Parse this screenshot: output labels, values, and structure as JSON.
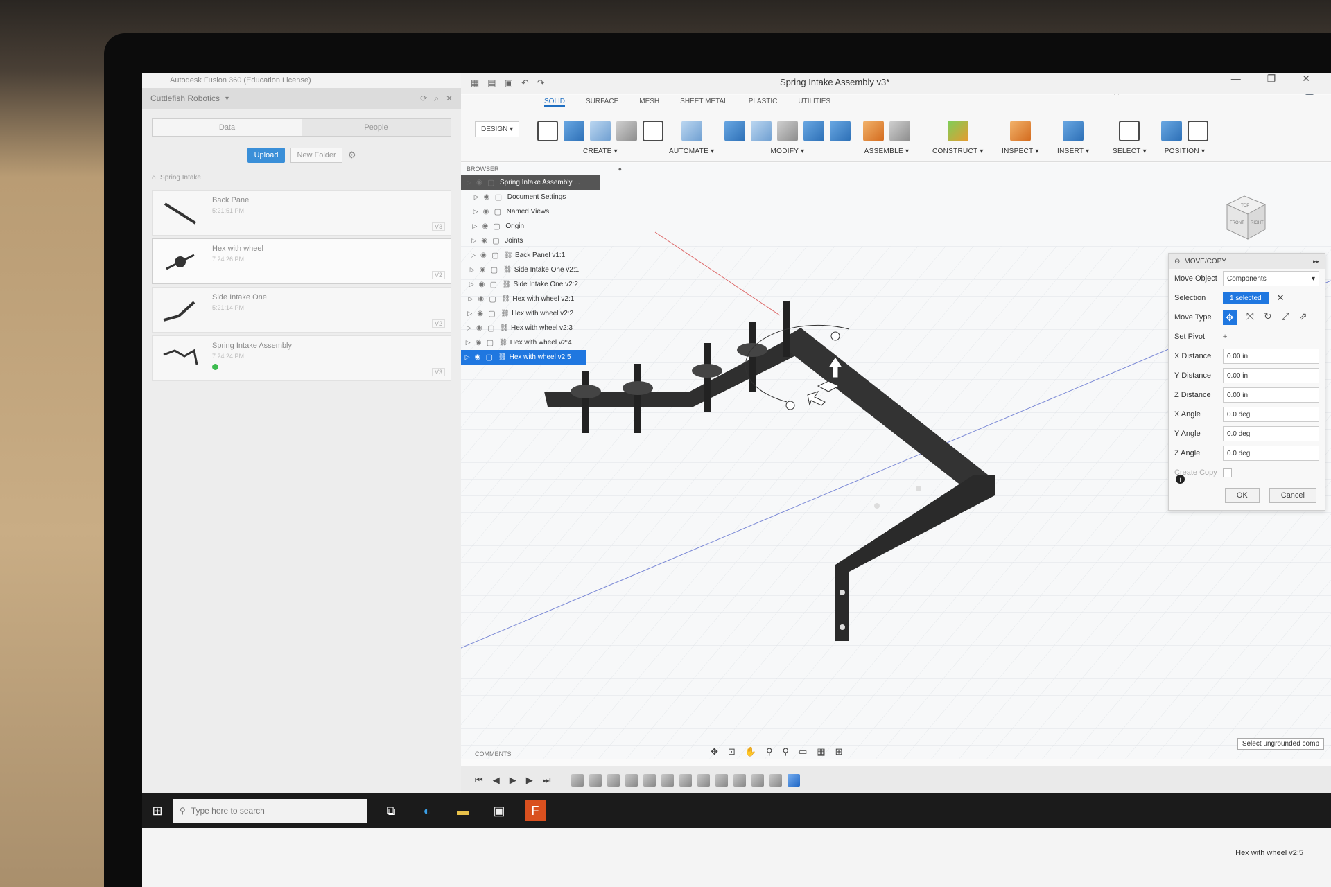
{
  "data_panel": {
    "app_title": "Autodesk Fusion 360 (Education License)",
    "team_name": "Cuttlefish Robotics",
    "tabs": [
      "Data",
      "People"
    ],
    "upload_label": "Upload",
    "new_folder_label": "New Folder",
    "breadcrumb": "Spring Intake",
    "items": [
      {
        "name": "Back Panel",
        "date": "5:21:51 PM",
        "version": "V3"
      },
      {
        "name": "Hex with wheel",
        "date": "7:24:26 PM",
        "version": "V2"
      },
      {
        "name": "Side Intake One",
        "date": "5:21:14 PM",
        "version": "V2"
      },
      {
        "name": "Spring Intake Assembly",
        "date": "7:24:24 PM",
        "version": "V3"
      }
    ]
  },
  "window": {
    "doc_title": "Spring Intake Assembly v3*",
    "controls": [
      "—",
      "❐",
      "✕"
    ]
  },
  "toolbar": {
    "workspace_tabs": [
      "SOLID",
      "SURFACE",
      "MESH",
      "SHEET METAL",
      "PLASTIC",
      "UTILITIES"
    ],
    "design_label": "DESIGN ▾",
    "groups": [
      "CREATE ▾",
      "AUTOMATE ▾",
      "MODIFY ▾",
      "ASSEMBLE ▾",
      "CONSTRUCT ▾",
      "INSPECT ▾",
      "INSERT ▾",
      "SELECT ▾",
      "POSITION ▾"
    ]
  },
  "browser": {
    "title": "BROWSER",
    "rows": [
      {
        "label": "Spring Intake Assembly ...",
        "kind": "root"
      },
      {
        "label": "Document Settings",
        "kind": "normal"
      },
      {
        "label": "Named Views",
        "kind": "normal"
      },
      {
        "label": "Origin",
        "kind": "normal"
      },
      {
        "label": "Joints",
        "kind": "normal"
      },
      {
        "label": "Back Panel v1:1",
        "kind": "normal"
      },
      {
        "label": "Side Intake One v2:1",
        "kind": "normal"
      },
      {
        "label": "Side Intake One v2:2",
        "kind": "normal"
      },
      {
        "label": "Hex with wheel v2:1",
        "kind": "normal"
      },
      {
        "label": "Hex with wheel v2:2",
        "kind": "normal"
      },
      {
        "label": "Hex with wheel v2:3",
        "kind": "normal"
      },
      {
        "label": "Hex with wheel v2:4",
        "kind": "normal"
      },
      {
        "label": "Hex with wheel v2:5",
        "kind": "selected"
      }
    ]
  },
  "viewcube": {
    "top": "TOP",
    "front": "FRONT",
    "right": "RIGHT"
  },
  "move_copy": {
    "title": "MOVE/COPY",
    "move_object_label": "Move Object",
    "move_object_value": "Components",
    "selection_label": "Selection",
    "selection_value": "1 selected",
    "move_type_label": "Move Type",
    "set_pivot_label": "Set Pivot",
    "fields": [
      {
        "label": "X Distance",
        "value": "0.00 in"
      },
      {
        "label": "Y Distance",
        "value": "0.00 in"
      },
      {
        "label": "Z Distance",
        "value": "0.00 in"
      },
      {
        "label": "X Angle",
        "value": "0.0 deg"
      },
      {
        "label": "Y Angle",
        "value": "0.0 deg"
      },
      {
        "label": "Z Angle",
        "value": "0.0 deg"
      }
    ],
    "create_copy_label": "Create Copy",
    "ok_label": "OK",
    "cancel_label": "Cancel"
  },
  "timeline": {
    "comments_label": "COMMENTS"
  },
  "status": {
    "hint": "Select ungrounded comp",
    "cursor_label": "Hex with wheel v2:5"
  },
  "taskbar": {
    "search_placeholder": "Type here to search"
  }
}
